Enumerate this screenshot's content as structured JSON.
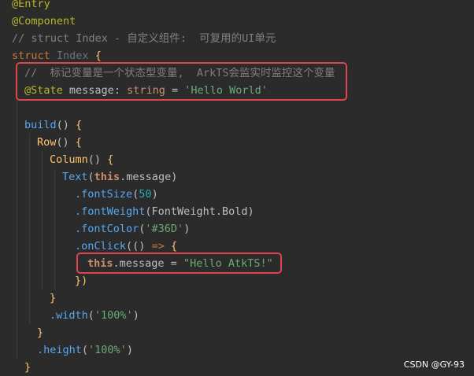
{
  "editor": {
    "lines": [
      {
        "indent": 0,
        "tokens": [
          {
            "t": "@Entry",
            "c": "ann"
          }
        ]
      },
      {
        "indent": 0,
        "tokens": [
          {
            "t": "@Component",
            "c": "ann"
          }
        ]
      },
      {
        "indent": 0,
        "tokens": [
          {
            "t": "// struct Index - 自定义组件:  可复用的UI单元",
            "c": "cmt"
          }
        ]
      },
      {
        "indent": 0,
        "tokens": [
          {
            "t": "struct ",
            "c": "kw"
          },
          {
            "t": "Index ",
            "c": "cls"
          },
          {
            "t": "{",
            "c": "fn"
          }
        ]
      },
      {
        "indent": 1,
        "tokens": [
          {
            "t": "//  标记变量是一个状态型变量,  ArkTS会监实时监控这个变量",
            "c": "cmt"
          }
        ]
      },
      {
        "indent": 1,
        "tokens": [
          {
            "t": "@State ",
            "c": "ann"
          },
          {
            "t": "message",
            "c": "plain"
          },
          {
            "t": ": ",
            "c": "sym"
          },
          {
            "t": "string",
            "c": "typ"
          },
          {
            "t": " = ",
            "c": "sym"
          },
          {
            "t": "'Hello World'",
            "c": "str"
          }
        ]
      },
      {
        "indent": 0,
        "tokens": []
      },
      {
        "indent": 1,
        "tokens": [
          {
            "t": "build",
            "c": "fdecl"
          },
          {
            "t": "() ",
            "c": "sym"
          },
          {
            "t": "{",
            "c": "fn"
          }
        ]
      },
      {
        "indent": 2,
        "tokens": [
          {
            "t": "Row",
            "c": "fn"
          },
          {
            "t": "() ",
            "c": "sym"
          },
          {
            "t": "{",
            "c": "fn"
          }
        ]
      },
      {
        "indent": 3,
        "tokens": [
          {
            "t": "Column",
            "c": "fn"
          },
          {
            "t": "() ",
            "c": "sym"
          },
          {
            "t": "{",
            "c": "fn"
          }
        ]
      },
      {
        "indent": 4,
        "tokens": [
          {
            "t": "Text",
            "c": "mth"
          },
          {
            "t": "(",
            "c": "sym"
          },
          {
            "t": "this",
            "c": "this"
          },
          {
            "t": ".message",
            "c": "plain"
          },
          {
            "t": ")",
            "c": "sym"
          }
        ]
      },
      {
        "indent": 5,
        "tokens": [
          {
            "t": ".fontSize",
            "c": "mth"
          },
          {
            "t": "(",
            "c": "sym"
          },
          {
            "t": "50",
            "c": "num"
          },
          {
            "t": ")",
            "c": "sym"
          }
        ]
      },
      {
        "indent": 5,
        "tokens": [
          {
            "t": ".fontWeight",
            "c": "mth"
          },
          {
            "t": "(",
            "c": "sym"
          },
          {
            "t": "FontWeight",
            "c": "plain"
          },
          {
            "t": ".Bold",
            "c": "plain"
          },
          {
            "t": ")",
            "c": "sym"
          }
        ]
      },
      {
        "indent": 5,
        "tokens": [
          {
            "t": ".fontColor",
            "c": "mth"
          },
          {
            "t": "(",
            "c": "sym"
          },
          {
            "t": "'#36D'",
            "c": "str"
          },
          {
            "t": ")",
            "c": "sym"
          }
        ]
      },
      {
        "indent": 5,
        "tokens": [
          {
            "t": ".onClick",
            "c": "mth"
          },
          {
            "t": "(",
            "c": "sym"
          },
          {
            "t": "() ",
            "c": "sym"
          },
          {
            "t": "=> ",
            "c": "kw"
          },
          {
            "t": "{",
            "c": "fn"
          }
        ]
      },
      {
        "indent": 6,
        "tokens": [
          {
            "t": "this",
            "c": "this"
          },
          {
            "t": ".message",
            "c": "plain"
          },
          {
            "t": " = ",
            "c": "sym"
          },
          {
            "t": "\"Hello AtkTS!\"",
            "c": "str"
          }
        ]
      },
      {
        "indent": 5,
        "tokens": [
          {
            "t": "})",
            "c": "fn"
          }
        ]
      },
      {
        "indent": 3,
        "tokens": [
          {
            "t": "}",
            "c": "fn"
          }
        ]
      },
      {
        "indent": 3,
        "tokens": [
          {
            "t": ".width",
            "c": "mth"
          },
          {
            "t": "(",
            "c": "sym"
          },
          {
            "t": "'100%'",
            "c": "str"
          },
          {
            "t": ")",
            "c": "sym"
          }
        ]
      },
      {
        "indent": 2,
        "tokens": [
          {
            "t": "}",
            "c": "fn"
          }
        ]
      },
      {
        "indent": 2,
        "tokens": [
          {
            "t": ".height",
            "c": "mth"
          },
          {
            "t": "(",
            "c": "sym"
          },
          {
            "t": "'100%'",
            "c": "str"
          },
          {
            "t": ")",
            "c": "sym"
          }
        ]
      },
      {
        "indent": 1,
        "tokens": [
          {
            "t": "}",
            "c": "fn"
          }
        ]
      }
    ]
  },
  "highlights": [
    {
      "name": "state-declaration-highlight",
      "from_line": 4,
      "to_line": 5
    },
    {
      "name": "message-assignment-highlight",
      "from_line": 15,
      "to_line": 15
    }
  ],
  "watermark": "CSDN @GY-93",
  "colors": {
    "background": "#2b2b2b",
    "highlight_border": "#e0444f"
  }
}
